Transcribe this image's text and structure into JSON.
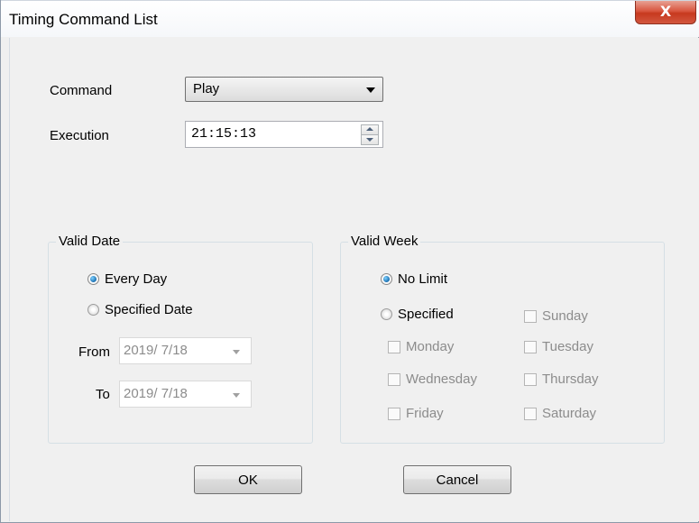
{
  "window": {
    "title": "Timing Command List",
    "close_label": "X"
  },
  "form": {
    "command_label": "Command",
    "command_value": "Play",
    "execution_label": "Execution",
    "execution_value": "21:15:13"
  },
  "valid_date": {
    "title": "Valid Date",
    "every_day": "Every Day",
    "specified_date": "Specified Date",
    "selected": "every_day",
    "from_label": "From",
    "from_value": "2019/  7/18",
    "to_label": "To",
    "to_value": "2019/  7/18"
  },
  "valid_week": {
    "title": "Valid Week",
    "no_limit": "No Limit",
    "specified": "Specified",
    "selected": "no_limit",
    "days": {
      "sunday": "Sunday",
      "monday": "Monday",
      "tuesday": "Tuesday",
      "wednesday": "Wednesday",
      "thursday": "Thursday",
      "friday": "Friday",
      "saturday": "Saturday"
    }
  },
  "buttons": {
    "ok": "OK",
    "cancel": "Cancel"
  }
}
